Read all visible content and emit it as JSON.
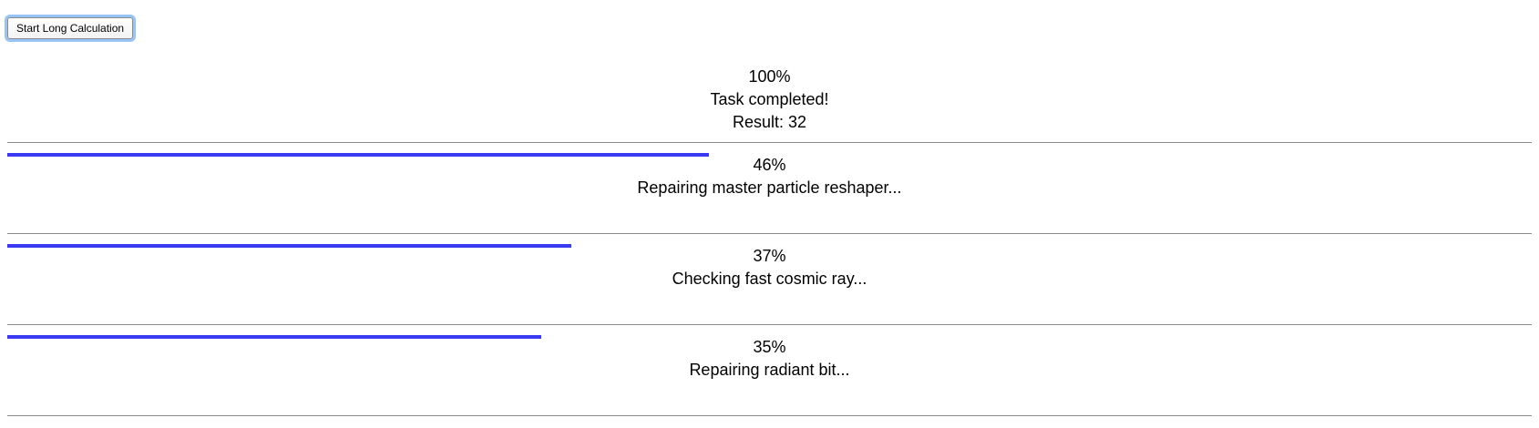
{
  "toolbar": {
    "start_button_label": "Start Long Calculation"
  },
  "colors": {
    "progress_bar": "#3a3af0",
    "divider": "#8a8a8a",
    "button_focus_ring": "#98c3f7"
  },
  "tasks": [
    {
      "percent_label": "100%",
      "progress": 1.0,
      "show_bar": false,
      "status": "Task completed!",
      "result": "Result: 32"
    },
    {
      "percent_label": "46%",
      "progress": 0.46,
      "show_bar": true,
      "status": "Repairing master particle reshaper...",
      "result": ""
    },
    {
      "percent_label": "37%",
      "progress": 0.37,
      "show_bar": true,
      "status": "Checking fast cosmic ray...",
      "result": ""
    },
    {
      "percent_label": "35%",
      "progress": 0.35,
      "show_bar": true,
      "status": "Repairing radiant bit...",
      "result": ""
    }
  ]
}
